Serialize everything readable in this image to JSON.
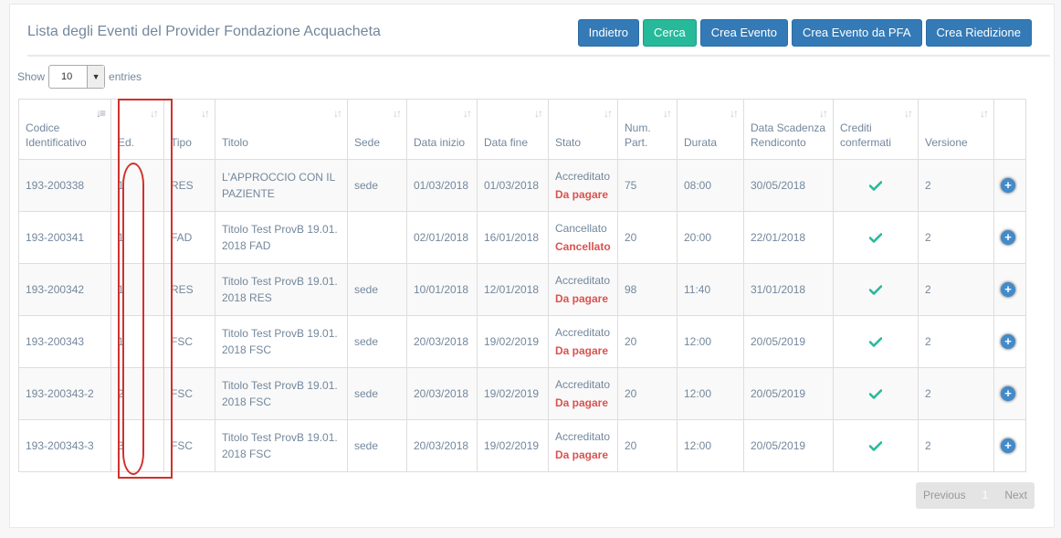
{
  "header": {
    "title": "Lista degli Eventi del Provider Fondazione Acquacheta",
    "buttons": {
      "back": "Indietro",
      "search": "Cerca",
      "create_event": "Crea Evento",
      "create_event_pfa": "Crea Evento da PFA",
      "create_reedition": "Crea Riedizione"
    }
  },
  "length": {
    "prefix": "Show",
    "value": "10",
    "suffix": "entries"
  },
  "table": {
    "columns": [
      {
        "key": "codice",
        "label": "Codice Identificativo"
      },
      {
        "key": "ed",
        "label": "Ed."
      },
      {
        "key": "tipo",
        "label": "Tipo"
      },
      {
        "key": "titolo",
        "label": "Titolo"
      },
      {
        "key": "sede",
        "label": "Sede"
      },
      {
        "key": "data_inizio",
        "label": "Data inizio"
      },
      {
        "key": "data_fine",
        "label": "Data fine"
      },
      {
        "key": "stato",
        "label": "Stato"
      },
      {
        "key": "num_part",
        "label": "Num. Part."
      },
      {
        "key": "durata",
        "label": "Durata"
      },
      {
        "key": "data_scadenza",
        "label": "Data Scadenza Rendiconto"
      },
      {
        "key": "crediti",
        "label": "Crediti confermati"
      },
      {
        "key": "versione",
        "label": "Versione"
      }
    ],
    "rows": [
      {
        "codice": "193-200338",
        "ed": "1",
        "tipo": "RES",
        "titolo": "L'APPROCCIO CON IL PAZIENTE",
        "sede": "sede",
        "data_inizio": "01/03/2018",
        "data_fine": "01/03/2018",
        "stato": "Accreditato",
        "stato_pagamento": "Da pagare",
        "num_part": "75",
        "durata": "08:00",
        "data_scadenza": "30/05/2018",
        "crediti_icon": "check-icon",
        "versione": "2"
      },
      {
        "codice": "193-200341",
        "ed": "1",
        "tipo": "FAD",
        "titolo": "Titolo Test ProvB 19.01. 2018 FAD",
        "sede": "",
        "data_inizio": "02/01/2018",
        "data_fine": "16/01/2018",
        "stato": "Cancellato",
        "stato_pagamento": "Cancellato",
        "num_part": "20",
        "durata": "20:00",
        "data_scadenza": "22/01/2018",
        "crediti_icon": "check-icon",
        "versione": "2"
      },
      {
        "codice": "193-200342",
        "ed": "1",
        "tipo": "RES",
        "titolo": "Titolo Test ProvB 19.01. 2018 RES",
        "sede": "sede",
        "data_inizio": "10/01/2018",
        "data_fine": "12/01/2018",
        "stato": "Accreditato",
        "stato_pagamento": "Da pagare",
        "num_part": "98",
        "durata": "11:40",
        "data_scadenza": "31/01/2018",
        "crediti_icon": "check-icon",
        "versione": "2"
      },
      {
        "codice": "193-200343",
        "ed": "1",
        "tipo": "FSC",
        "titolo": "Titolo Test ProvB 19.01. 2018 FSC",
        "sede": "sede",
        "data_inizio": "20/03/2018",
        "data_fine": "19/02/2019",
        "stato": "Accreditato",
        "stato_pagamento": "Da pagare",
        "num_part": "20",
        "durata": "12:00",
        "data_scadenza": "20/05/2019",
        "crediti_icon": "check-icon",
        "versione": "2"
      },
      {
        "codice": "193-200343-2",
        "ed": "2",
        "tipo": "FSC",
        "titolo": "Titolo Test ProvB 19.01. 2018 FSC",
        "sede": "sede",
        "data_inizio": "20/03/2018",
        "data_fine": "19/02/2019",
        "stato": "Accreditato",
        "stato_pagamento": "Da pagare",
        "num_part": "20",
        "durata": "12:00",
        "data_scadenza": "20/05/2019",
        "crediti_icon": "check-icon",
        "versione": "2"
      },
      {
        "codice": "193-200343-3",
        "ed": "3",
        "tipo": "FSC",
        "titolo": "Titolo Test ProvB 19.01. 2018 FSC",
        "sede": "sede",
        "data_inizio": "20/03/2018",
        "data_fine": "19/02/2019",
        "stato": "Accreditato",
        "stato_pagamento": "Da pagare",
        "num_part": "20",
        "durata": "12:00",
        "data_scadenza": "20/05/2019",
        "crediti_icon": "check-icon",
        "versione": "2"
      }
    ]
  },
  "pagination": {
    "previous": "Previous",
    "current": "1",
    "next": "Next"
  },
  "colors": {
    "primary": "#337ab7",
    "success": "#26b99a",
    "danger": "#d9534f",
    "check": "#26b99a",
    "annotation": "#d0312d"
  }
}
